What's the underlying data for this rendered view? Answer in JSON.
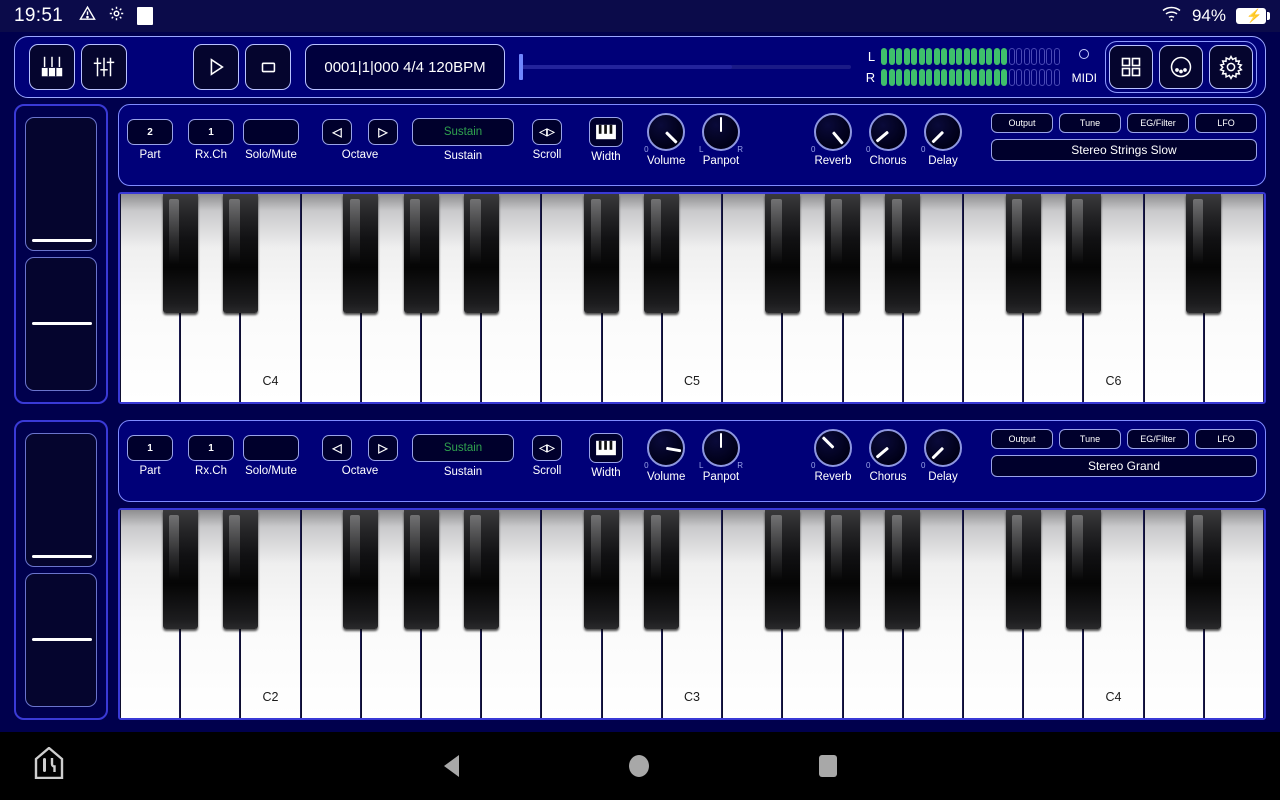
{
  "status_bar": {
    "time": "19:51",
    "battery_percent": "94%",
    "icons": [
      "warning-icon",
      "gear-icon",
      "white-square-icon",
      "wifi-icon",
      "battery-charging-icon"
    ]
  },
  "toolbar": {
    "keyboard_view_button": "keyboard-icon",
    "mixer_view_button": "faders-icon",
    "play_button": "play-icon",
    "stop_button": "stop-icon",
    "position_display": "0001|1|000 4/4 120BPM",
    "slider_value_percent": 0,
    "meter": {
      "left_label": "L",
      "right_label": "R",
      "total_segments": 24,
      "left_lit": 17,
      "right_lit": 17,
      "on_color": "#3fbf6b",
      "off_color": "#4a4ab5"
    },
    "midi_label": "MIDI",
    "grid_button": "grid-icon",
    "knobs_button": "pads-icon",
    "settings_button": "gear-icon"
  },
  "parts": [
    {
      "part": "2",
      "rx_ch": "1",
      "solo_mute": "",
      "labels": {
        "part": "Part",
        "rx_ch": "Rx.Ch",
        "solo_mute": "Solo/Mute",
        "octave": "Octave",
        "sustain": "Sustain",
        "scroll": "Scroll",
        "width": "Width",
        "volume": "Volume",
        "panpot": "Panpot",
        "reverb": "Reverb",
        "chorus": "Chorus",
        "delay": "Delay"
      },
      "octave_down": "◁",
      "octave_up": "▷",
      "sustain_text": "Sustain",
      "scroll_text": "◁▷",
      "knobs": {
        "volume": 135,
        "panpot": 0,
        "reverb": 140,
        "chorus": -130,
        "delay": -135
      },
      "knob_marks": {
        "volume_min": "0",
        "panpot_left": "L",
        "panpot_right": "R",
        "reverb_min": "0",
        "chorus_min": "0",
        "delay_min": "0"
      },
      "edit_buttons": [
        "Output",
        "Tune",
        "EG/Filter",
        "LFO"
      ],
      "voice_name": "Stereo Strings Slow",
      "keyboard": {
        "white_keys": 19,
        "start_note": "C",
        "labels": [
          "C4",
          "C5",
          "C6"
        ],
        "label_at_white_index": [
          2,
          9,
          16
        ]
      }
    },
    {
      "part": "1",
      "rx_ch": "1",
      "solo_mute": "",
      "labels": {
        "part": "Part",
        "rx_ch": "Rx.Ch",
        "solo_mute": "Solo/Mute",
        "octave": "Octave",
        "sustain": "Sustain",
        "scroll": "Scroll",
        "width": "Width",
        "volume": "Volume",
        "panpot": "Panpot",
        "reverb": "Reverb",
        "chorus": "Chorus",
        "delay": "Delay"
      },
      "octave_down": "◁",
      "octave_up": "▷",
      "sustain_text": "Sustain",
      "scroll_text": "◁▷",
      "knobs": {
        "volume": 100,
        "panpot": 0,
        "reverb": -45,
        "chorus": -130,
        "delay": -135
      },
      "knob_marks": {
        "volume_min": "0",
        "panpot_left": "L",
        "panpot_right": "R",
        "reverb_min": "0",
        "chorus_min": "0",
        "delay_min": "0"
      },
      "edit_buttons": [
        "Output",
        "Tune",
        "EG/Filter",
        "LFO"
      ],
      "voice_name": "Stereo Grand",
      "keyboard": {
        "white_keys": 19,
        "start_note": "C",
        "labels": [
          "C2",
          "C3",
          "C4"
        ],
        "label_at_white_index": [
          2,
          9,
          16
        ]
      }
    }
  ],
  "nav_bar": {
    "app_icon": "app-shortcut-icon",
    "back": "back-icon",
    "home": "home-icon",
    "recents": "recents-icon"
  }
}
